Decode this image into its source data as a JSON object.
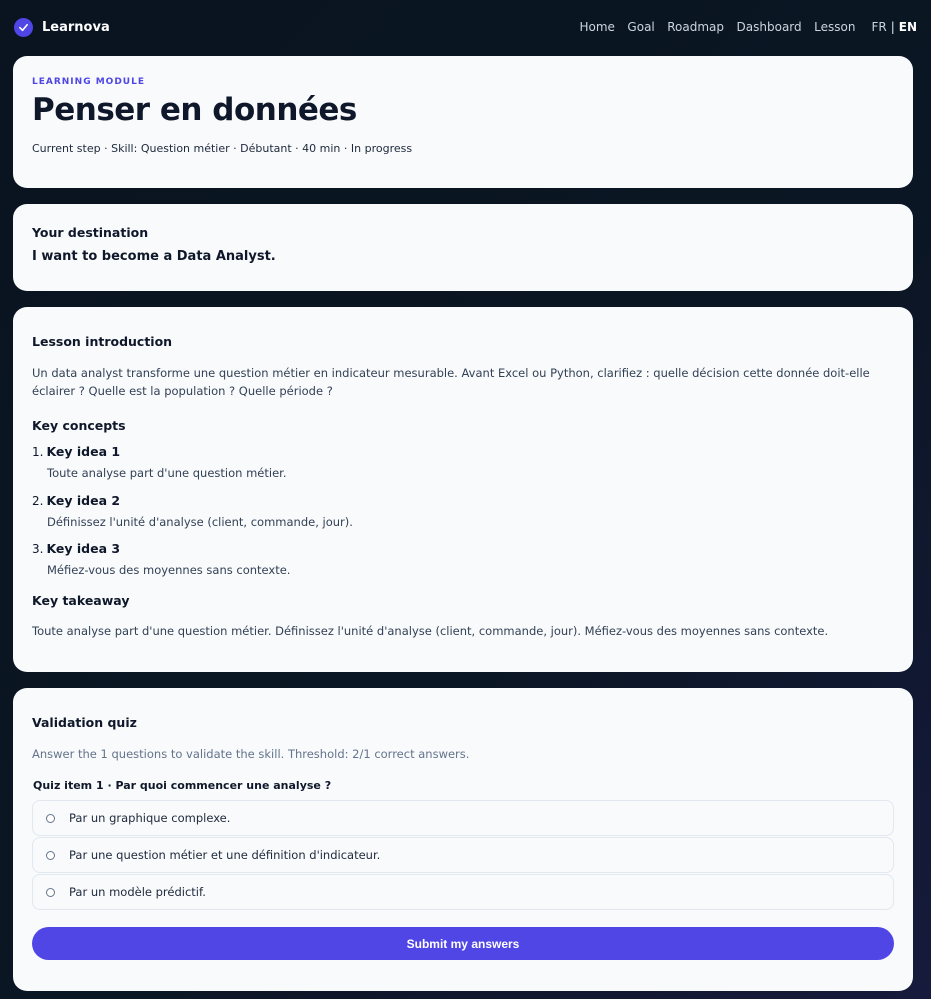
{
  "brand": {
    "name": "Learnova",
    "icon": "check-icon",
    "accent": "#4f46e5"
  },
  "nav": {
    "items": [
      {
        "label": "Home"
      },
      {
        "label": "Goal"
      },
      {
        "label": "Roadmap"
      },
      {
        "label": "Dashboard"
      },
      {
        "label": "Lesson"
      }
    ],
    "languages": {
      "fr": "FR",
      "separator": "|",
      "en": "EN",
      "active": "EN"
    }
  },
  "module": {
    "eyebrow": "LEARNING MODULE",
    "title": "Penser en données",
    "meta": "Current step · Skill: Question métier · Débutant · 40 min · In progress"
  },
  "destination": {
    "heading": "Your destination",
    "text": "I want to become a Data Analyst."
  },
  "lesson": {
    "heading": "Lesson introduction",
    "intro": "Un data analyst transforme une question métier en indicateur mesurable. Avant Excel ou Python, clarifiez : quelle décision cette donnée doit-elle éclairer ? Quelle est la population ? Quelle période ?",
    "concepts_heading": "Key concepts",
    "concepts": [
      {
        "num": "1.",
        "title": "Key idea 1",
        "desc": "Toute analyse part d'une question métier."
      },
      {
        "num": "2.",
        "title": "Key idea 2",
        "desc": "Définissez l'unité d'analyse (client, commande, jour)."
      },
      {
        "num": "3.",
        "title": "Key idea 3",
        "desc": "Méfiez-vous des moyennes sans contexte."
      }
    ],
    "takeaway_heading": "Key takeaway",
    "takeaway": "Toute analyse part d'une question métier. Définissez l'unité d'analyse (client, commande, jour). Méfiez-vous des moyennes sans contexte."
  },
  "quiz": {
    "heading": "Validation quiz",
    "instructions": "Answer the 1 questions to validate the skill. Threshold: 2/1 correct answers.",
    "question": "Quiz item 1 · Par quoi commencer une analyse ?",
    "options": [
      {
        "label": "Par un graphique complexe."
      },
      {
        "label": "Par une question métier et une définition d'indicateur."
      },
      {
        "label": "Par un modèle prédictif."
      }
    ],
    "submit_label": "Submit my answers"
  }
}
